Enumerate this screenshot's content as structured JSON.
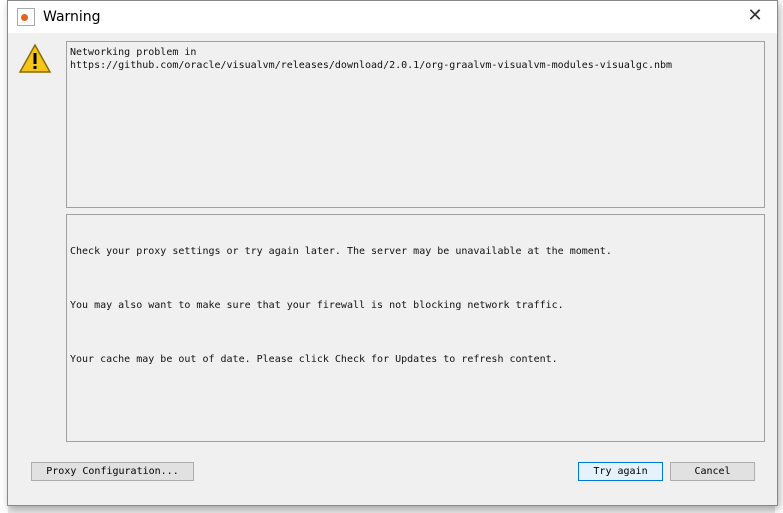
{
  "dialog": {
    "title": "Warning",
    "close_icon": "close-icon",
    "warning_icon": "warning-triangle-icon"
  },
  "message": {
    "line1": "Networking problem in",
    "line2": "https://github.com/oracle/visualvm/releases/download/2.0.1/org-graalvm-visualvm-modules-visualgc.nbm"
  },
  "details": [
    "Check your proxy settings or try again later. The server may be unavailable at the moment.",
    "You may also want to make sure that your firewall is not blocking network traffic.",
    "Your cache may be out of date. Please click Check for Updates to refresh content."
  ],
  "buttons": {
    "proxy": "Proxy Configuration...",
    "try_again": "Try again",
    "cancel": "Cancel"
  }
}
